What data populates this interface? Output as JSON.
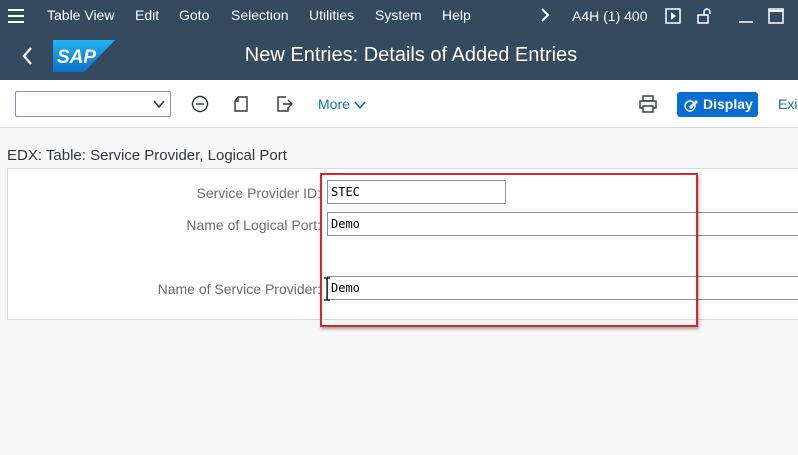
{
  "menubar": {
    "items": [
      "Table View",
      "Edit",
      "Goto",
      "Selection",
      "Utilities",
      "System",
      "Help"
    ],
    "system_info": "A4H (1) 400"
  },
  "titlebar": {
    "title": "New Entries: Details of Added Entries",
    "logo_text": "SAP"
  },
  "toolbar": {
    "command_field_value": "",
    "more_label": "More",
    "display_label": "Display",
    "exit_label": "Exi"
  },
  "content": {
    "section_title": "EDX: Table: Service Provider, Logical Port",
    "fields": {
      "service_provider_id": {
        "label": "Service Provider ID:",
        "value": "STEC"
      },
      "logical_port": {
        "label": "Name of Logical Port:",
        "value": "Demo"
      },
      "service_provider_name": {
        "label": "Name of Service Provider:",
        "value": "Demo"
      }
    }
  },
  "colors": {
    "shell": "#354a5f",
    "accent": "#0a6ed1",
    "highlight": "#d3262e"
  },
  "icons": [
    "menu-icon",
    "chevron-right-icon",
    "play-icon",
    "unlock-icon",
    "minimize-icon",
    "maximize-icon",
    "back-icon",
    "dropdown-icon",
    "minus-circle-icon",
    "new-entry-icon",
    "export-icon",
    "chevron-down-icon",
    "print-icon",
    "display-pencil-icon"
  ]
}
